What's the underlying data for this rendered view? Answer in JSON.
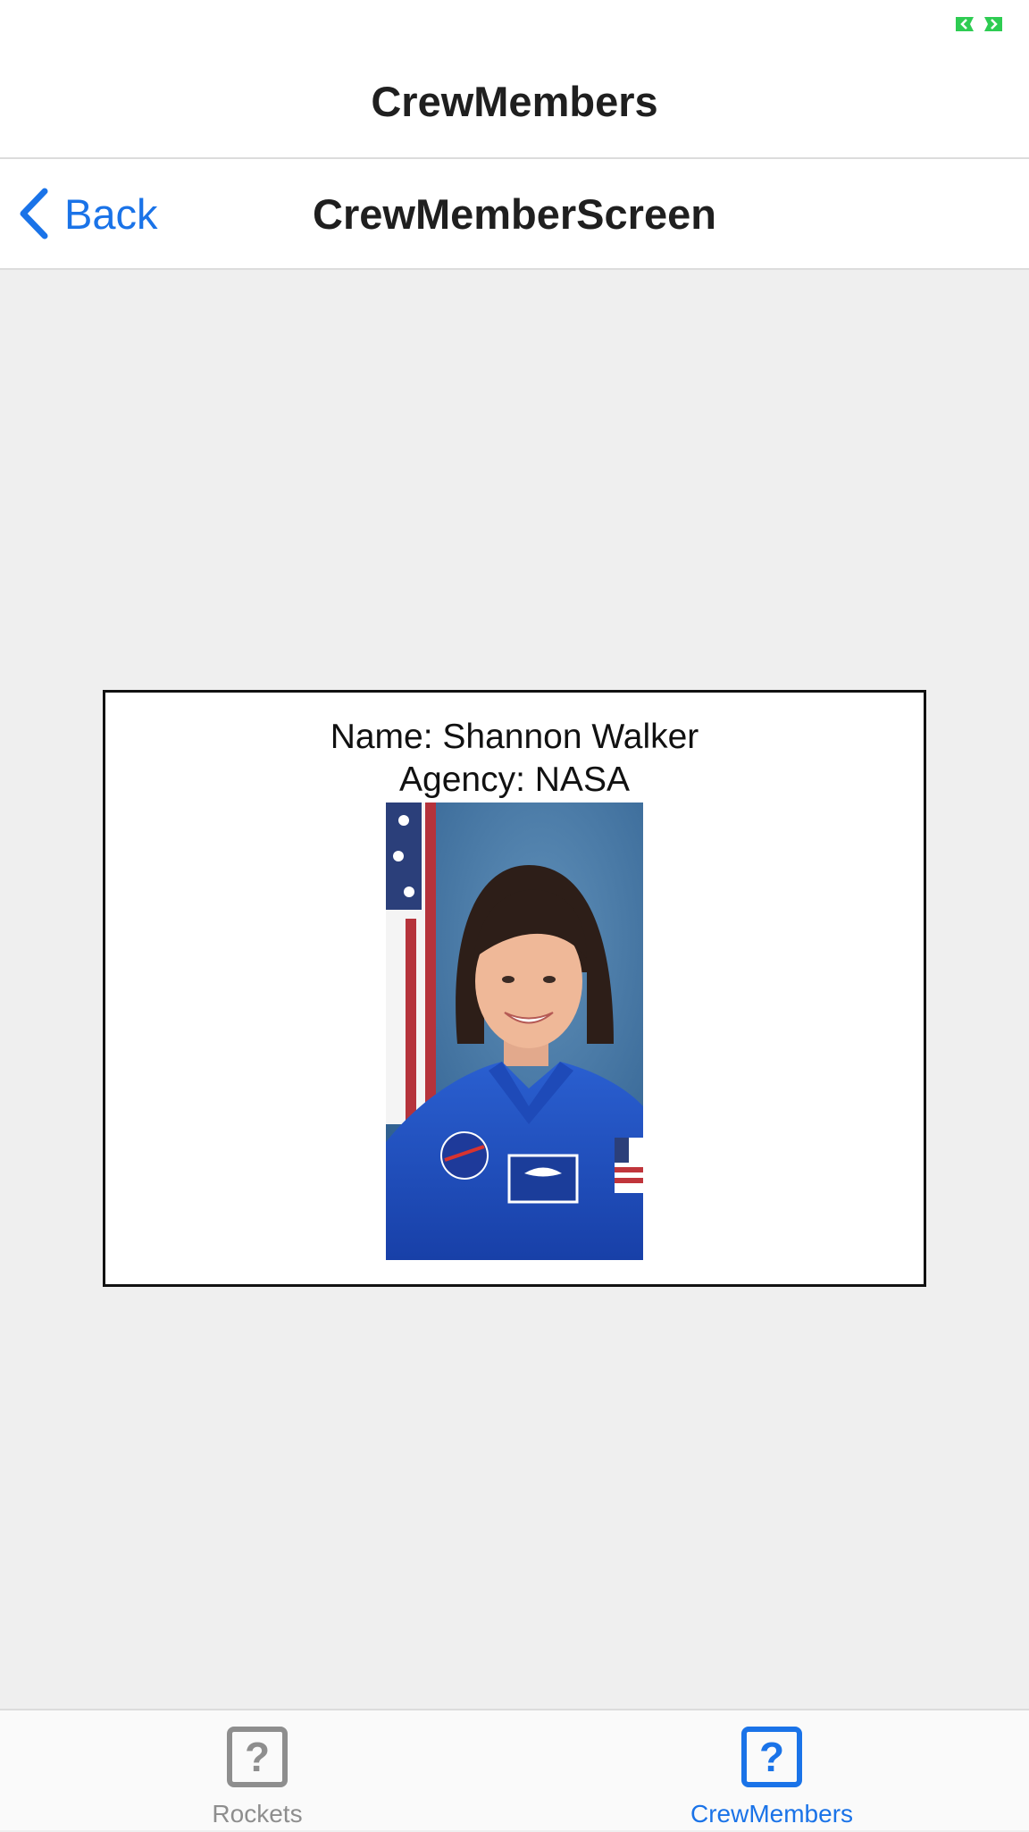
{
  "status": {
    "indicator_icon": "battery-indicator-icon",
    "indicator_color": "#2ecc52"
  },
  "top_header": {
    "title": "CrewMembers"
  },
  "nav_bar": {
    "back_label": "Back",
    "back_icon": "chevron-left-icon",
    "title": "CrewMemberScreen"
  },
  "crew_member": {
    "name_text": "Name: Shannon Walker",
    "agency_text": "Agency: NASA",
    "photo_alt": "Shannon Walker"
  },
  "tab_bar": {
    "tabs": [
      {
        "label": "Rockets",
        "icon": "question-mark-icon",
        "active": false
      },
      {
        "label": "CrewMembers",
        "icon": "question-mark-icon",
        "active": true
      }
    ],
    "icon_glyph": "?"
  },
  "colors": {
    "accent": "#1a73e8",
    "inactive": "#8e8e8e",
    "background": "#efefef"
  }
}
